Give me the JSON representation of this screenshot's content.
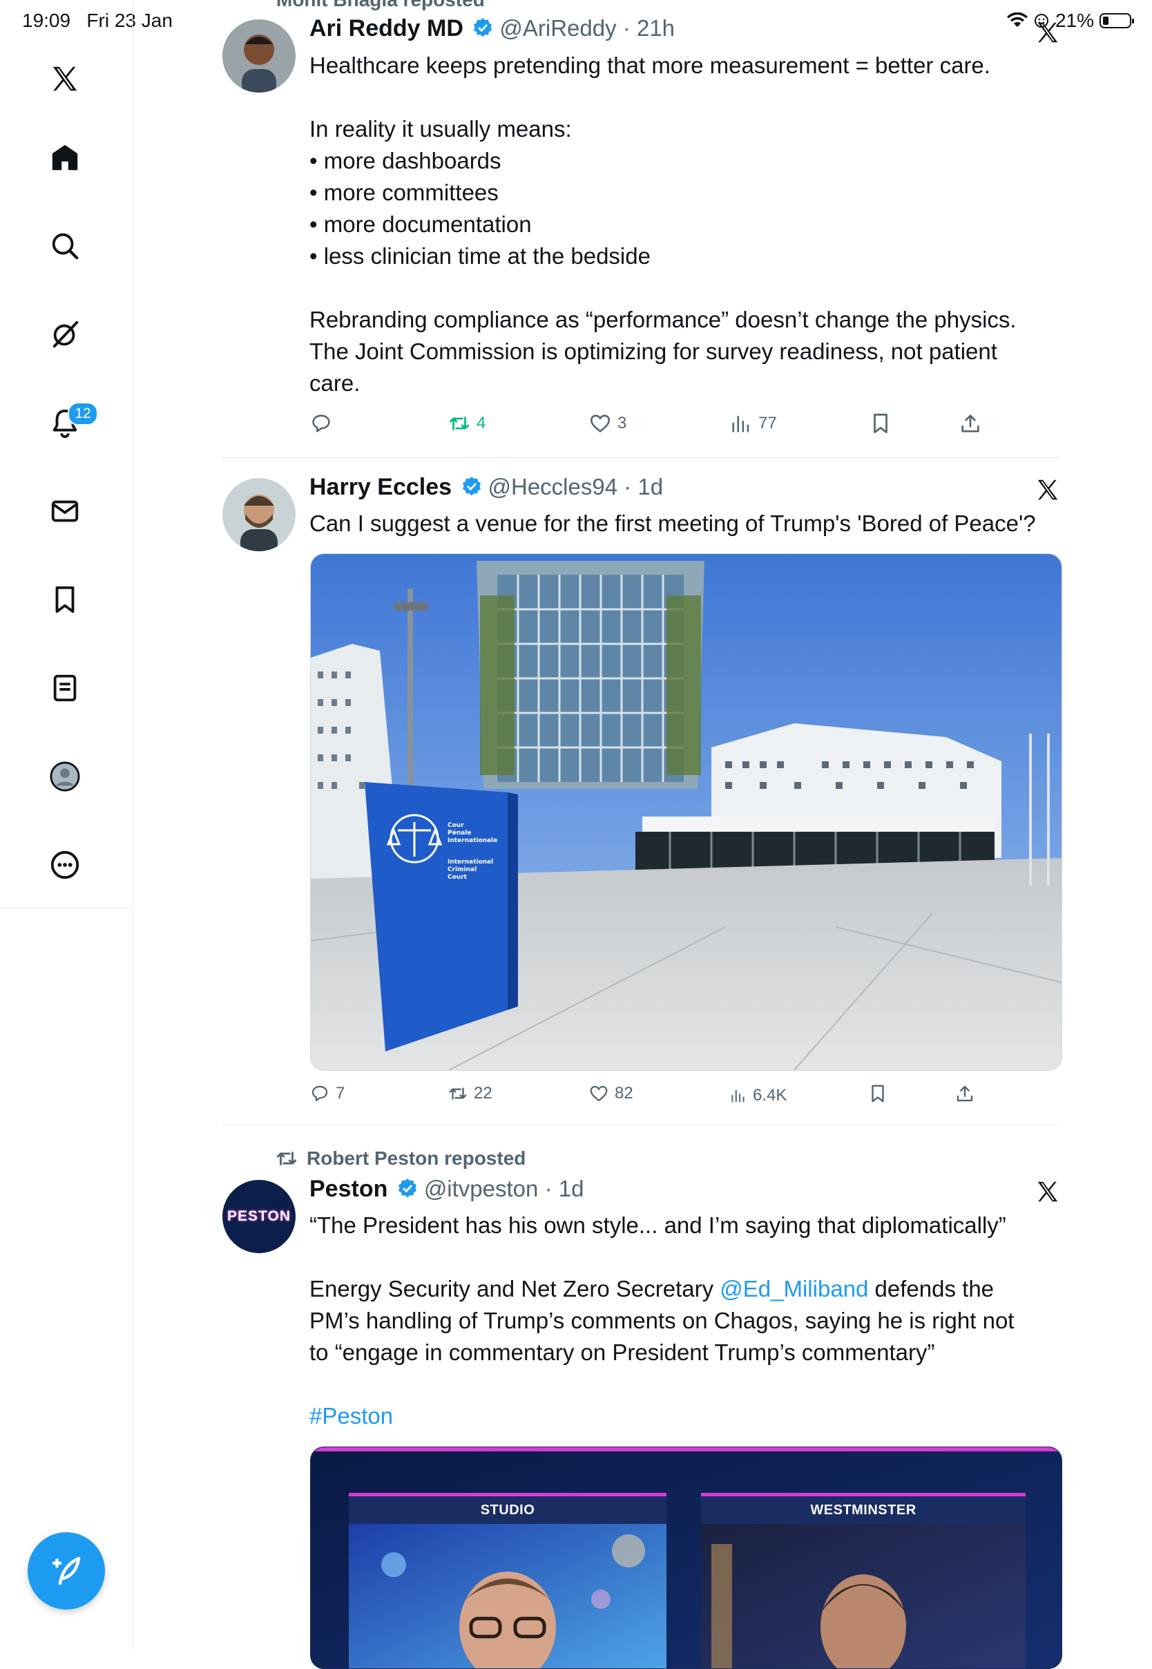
{
  "status_bar": {
    "time": "19:09",
    "date": "Fri 23 Jan",
    "battery": "21%"
  },
  "sidebar": {
    "items": [
      {
        "name": "x-logo",
        "label": "X"
      },
      {
        "name": "home",
        "label": "Home"
      },
      {
        "name": "search",
        "label": "Search"
      },
      {
        "name": "grok",
        "label": "Grok"
      },
      {
        "name": "notifications",
        "label": "Notifications",
        "badge": "12"
      },
      {
        "name": "messages",
        "label": "Messages"
      },
      {
        "name": "bookmarks",
        "label": "Bookmarks"
      },
      {
        "name": "lists",
        "label": "Lists"
      },
      {
        "name": "profile",
        "label": "Profile"
      },
      {
        "name": "more",
        "label": "More"
      }
    ],
    "badge": "12"
  },
  "posts": [
    {
      "repost_line": "Mohit Bhagia reposted",
      "name": "Ari Reddy MD",
      "handle": "@AriReddy",
      "time": "21h",
      "lines": [
        "Healthcare keeps pretending that more measurement = better care.",
        "",
        "In reality it usually means:",
        "• more dashboards",
        "• more committees",
        "• more documentation",
        "• less clinician time at the bedside",
        "",
        "Rebranding compliance as “performance” doesn’t change the physics.",
        "The Joint Commission is optimizing for survey readiness, not patient",
        "care."
      ],
      "stats": {
        "replies": "",
        "reposts": "4",
        "likes": "3",
        "views": "77"
      }
    },
    {
      "name": "Harry Eccles",
      "handle": "@Heccles94",
      "time": "1d",
      "text": "Can I suggest a venue for the first meeting of Trump's 'Bored of Peace'?",
      "image": {
        "sign_fr": [
          "Cour",
          "Pénale",
          "Internationale"
        ],
        "sign_en": [
          "International",
          "Criminal",
          "Court"
        ]
      },
      "stats": {
        "replies": "7",
        "reposts": "22",
        "likes": "82",
        "views": "6.4K"
      }
    },
    {
      "repost_line": "Robert Peston reposted",
      "name": "Peston",
      "handle": "@itvpeston",
      "time": "1d",
      "avatar_text": "PESTON",
      "line1": "“The President has his own style... and I’m saying that diplomatically”",
      "line2_pre": "Energy Security and Net Zero Secretary ",
      "line2_mention": "@Ed_Miliband",
      "line2_post": " defends the",
      "line3": "PM’s handling of Trump’s comments on Chagos, saying he is right not",
      "line4": "to “engage in commentary on President Trump’s commentary”",
      "hashtag": "#Peston",
      "video": {
        "left_label": "STUDIO",
        "right_label": "WESTMINSTER"
      }
    }
  ],
  "colors": {
    "accent": "#1d9bf0",
    "repost_green": "#00ba7c",
    "muted": "#536471"
  }
}
